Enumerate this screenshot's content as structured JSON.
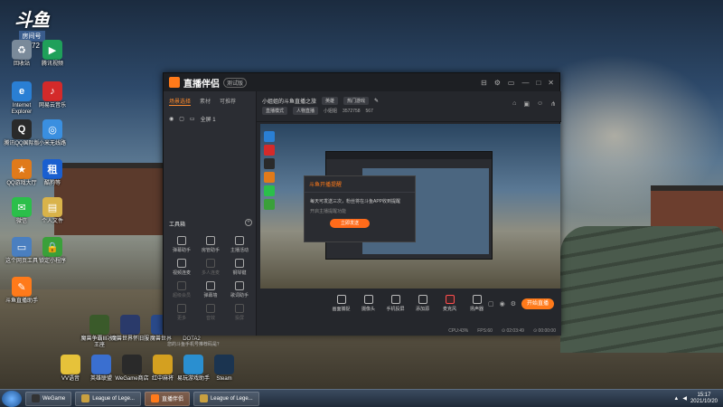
{
  "brand_tile": {
    "logo_text": "斗鱼",
    "room_label": "房间号",
    "room_id": "3572"
  },
  "desktop_icons": [
    {
      "name": "recycle-bin",
      "label": "回收站",
      "color": "#7a8a9a",
      "glyph": "♻"
    },
    {
      "name": "tencent-video",
      "label": "腾讯视频",
      "color": "#1fa05a",
      "glyph": "▶"
    },
    {
      "name": "ie",
      "label": "Internet Explorer",
      "color": "#2a7fd4",
      "glyph": "e"
    },
    {
      "name": "netease-music",
      "label": "网易云音乐",
      "color": "#d42a2a",
      "glyph": "♪"
    },
    {
      "name": "qq-international",
      "label": "腾讯QQ国际版",
      "color": "#2a2a2a",
      "glyph": "Q"
    },
    {
      "name": "xiaohongshu",
      "label": "小米无线路",
      "color": "#3a8fe0",
      "glyph": "◎"
    },
    {
      "name": "qq-games",
      "label": "QQ游戏大厅",
      "color": "#e07a1a",
      "glyph": "★"
    },
    {
      "name": "dot-tool",
      "label": "酷狗等",
      "color": "#1a5fd0",
      "glyph": "租"
    },
    {
      "name": "wechat",
      "label": "微信",
      "color": "#2bbf4a",
      "glyph": "✉"
    },
    {
      "name": "user-folder",
      "label": "个人文件",
      "color": "#d9b34a",
      "glyph": "▤"
    },
    {
      "name": "computer",
      "label": "这个网页工具",
      "color": "#4a7fc0",
      "glyph": "▭"
    },
    {
      "name": "lock-app",
      "label": "锁定小程序",
      "color": "#3aa03a",
      "glyph": "🔒"
    },
    {
      "name": "douyu-helper",
      "label": "斗鱼直播助手",
      "color": "#ff7a1a",
      "glyph": "✎"
    }
  ],
  "bottom_icons": [
    {
      "label": "VV语音",
      "color": "#e6c23a"
    },
    {
      "label": "英雄联盟",
      "color": "#3a6fd0"
    },
    {
      "label": "WeGame商店",
      "color": "#2a2a2a"
    },
    {
      "label": "红中麻将",
      "color": "#d4a020"
    },
    {
      "label": "易玩游戏助手",
      "color": "#2a8fd0"
    },
    {
      "label": "Steam",
      "color": "#1b3450"
    },
    {
      "label": "魔兽争霸III冰封王座",
      "color": "#3a5a2a"
    },
    {
      "label": "魔兽世界怀旧服",
      "color": "#2a3a6a"
    },
    {
      "label": "魔兽世界",
      "color": "#2a4a8a"
    },
    {
      "label": "DOTA2",
      "color": "#8a1a1a"
    }
  ],
  "app": {
    "title": "直播伴侣",
    "badge": "测试版",
    "window_buttons": [
      "⊟",
      "⚙",
      "▭",
      "—",
      "□",
      "✕"
    ],
    "tabs": [
      "场景选择",
      "素材",
      "可推荐"
    ],
    "scene_row": "全屏 1",
    "toolbox_title": "工具箱",
    "tools": [
      {
        "label": "弹幕助手",
        "dim": false
      },
      {
        "label": "房管助手",
        "dim": false
      },
      {
        "label": "主播活动",
        "dim": false
      },
      {
        "label": "视频连麦",
        "dim": false
      },
      {
        "label": "多人连麦",
        "dim": true
      },
      {
        "label": "钢琴键",
        "dim": false
      },
      {
        "label": "超级会员",
        "dim": true
      },
      {
        "label": "弹幕墙",
        "dim": false
      },
      {
        "label": "歌词助手",
        "dim": false
      },
      {
        "label": "更多",
        "dim": true
      },
      {
        "label": "音效",
        "dim": true
      },
      {
        "label": "投屏",
        "dim": true
      }
    ],
    "notice": "您的斗鱼手机号推荐码是？",
    "head": {
      "room_title": "小姐姐的斗鱼直播之旅",
      "pill1": "英雄",
      "pill2": "热门游戏",
      "line2_pills": [
        "直播模式",
        "人物直播"
      ],
      "level_label": "小姐姐",
      "fans": "3572758",
      "extra": "567"
    },
    "dialog": {
      "title": "斗鱼开播提醒",
      "body": "每天可发送三次，粉丝将在斗鱼APP收到提醒",
      "tip": "开启主播提醒功能",
      "button": "立即发送"
    },
    "controls": [
      {
        "label": "画面捕捉",
        "mic": false
      },
      {
        "label": "摄像头",
        "mic": false
      },
      {
        "label": "手机投屏",
        "mic": false
      },
      {
        "label": "添加源",
        "mic": false
      },
      {
        "label": "麦克风",
        "mic": true
      },
      {
        "label": "扬声器",
        "mic": false
      }
    ],
    "start_button": "开始直播",
    "status": [
      "CPU:43%",
      "FPS:60",
      "⊙ 02:03:49",
      "⊙ 00:00:00"
    ]
  },
  "taskbar": {
    "items": [
      {
        "label": "WeGame",
        "color": "#333",
        "active": false
      },
      {
        "label": "League of Lege...",
        "color": "#c8a040",
        "active": false
      },
      {
        "label": "直播伴侣",
        "color": "#ff7a1a",
        "active": true
      },
      {
        "label": "League of Lege...",
        "color": "#c8a040",
        "active": false
      }
    ],
    "time": "15:17",
    "date": "2021/10/20"
  }
}
